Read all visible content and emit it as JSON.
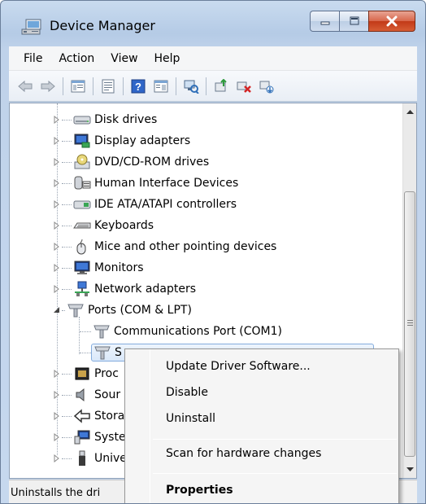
{
  "window": {
    "title": "Device Manager",
    "colors": {
      "accent": "#84acdd",
      "close": "#c23a18",
      "frame": "#b5cbe6"
    }
  },
  "menu": [
    "File",
    "Action",
    "View",
    "Help"
  ],
  "toolbar": {
    "icons": [
      "back-arrow-icon",
      "forward-arrow-icon",
      "properties-view-icon",
      "console-tree-icon",
      "help-icon",
      "action-pane-icon",
      "scan-hardware-icon",
      "update-driver-icon",
      "uninstall-icon",
      "enable-device-icon"
    ]
  },
  "tree": {
    "items": [
      {
        "label": "Disk drives",
        "icon": "disk-drive-icon"
      },
      {
        "label": "Display adapters",
        "icon": "display-adapter-icon"
      },
      {
        "label": "DVD/CD-ROM drives",
        "icon": "dvd-drive-icon"
      },
      {
        "label": "Human Interface Devices",
        "icon": "hid-icon"
      },
      {
        "label": "IDE ATA/ATAPI controllers",
        "icon": "ide-controller-icon"
      },
      {
        "label": "Keyboards",
        "icon": "keyboard-icon"
      },
      {
        "label": "Mice and other pointing devices",
        "icon": "mouse-icon"
      },
      {
        "label": "Monitors",
        "icon": "monitor-icon"
      },
      {
        "label": "Network adapters",
        "icon": "network-adapter-icon"
      },
      {
        "label": "Ports (COM & LPT)",
        "icon": "port-icon"
      },
      {
        "label": "Communications Port (COM1)",
        "icon": "port-icon"
      },
      {
        "label": "S",
        "icon": "port-icon"
      },
      {
        "label": "Proc",
        "icon": "processor-icon"
      },
      {
        "label": "Sour",
        "icon": "sound-icon"
      },
      {
        "label": "Stora",
        "icon": "storage-icon"
      },
      {
        "label": "Syste",
        "icon": "system-devices-icon"
      },
      {
        "label": "Unive",
        "icon": "usb-icon"
      }
    ]
  },
  "context_menu": {
    "items": [
      {
        "label": "Update Driver Software..."
      },
      {
        "label": "Disable"
      },
      {
        "label": "Uninstall"
      },
      {
        "label": "Scan for hardware changes"
      },
      {
        "label": "Properties"
      }
    ]
  },
  "status": {
    "text": "Uninstalls the dri"
  }
}
